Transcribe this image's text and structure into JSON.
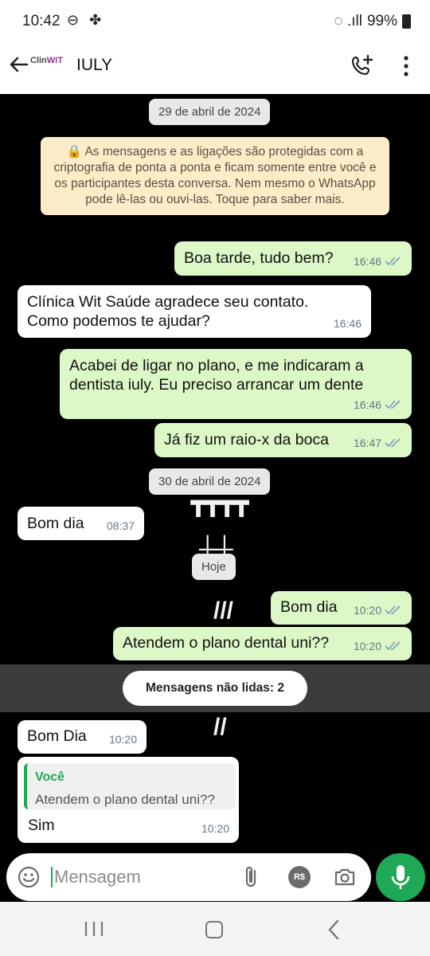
{
  "status_bar": {
    "time": "10:42",
    "icons": "⊖ ✤",
    "signal": "◌ .ıll",
    "battery": "99%"
  },
  "header": {
    "logo_prefix": "Clin",
    "logo_suffix": "WIT",
    "contact": "IULY"
  },
  "chat": {
    "dates": [
      "29 de abril de 2024",
      "30 de abril de 2024",
      "Hoje"
    ],
    "encryption_notice": "🔒 As mensagens e as ligações são protegidas com a criptografia de ponta a ponta e ficam somente entre você e os participantes desta conversa. Nem mesmo o WhatsApp pode lê-las ou ouvi-las. Toque para saber mais.",
    "messages": [
      {
        "text": "Boa tarde, tudo bem?",
        "time": "16:46"
      },
      {
        "text": "Clínica Wit Saúde agradece seu contato. Como podemos te ajudar?",
        "time": "16:46"
      },
      {
        "text": "Acabei de ligar no plano, e me indicaram a dentista iuly. Eu preciso arrancar um dente",
        "time": "16:46"
      },
      {
        "text": "Já fiz um raio-x da boca",
        "time": "16:47"
      },
      {
        "text": "Bom dia",
        "time": "08:37"
      },
      {
        "text": "Bom dia",
        "time": "10:20"
      },
      {
        "text": "Atendem o plano dental uni??",
        "time": "10:20"
      },
      {
        "text": "Bom Dia",
        "time": "10:20"
      },
      {
        "text": "Sim",
        "time": "10:20"
      }
    ],
    "unread_label": "Mensagens não lidas: 2",
    "reply_quote": {
      "author": "Você",
      "text": "Atendem o plano dental uni??"
    }
  },
  "input": {
    "placeholder": "Mensagem",
    "pix_label": "R$"
  },
  "colors": {
    "accent": "#1fa855",
    "outgoing": "#dcf8c6",
    "incoming": "#ffffff"
  }
}
